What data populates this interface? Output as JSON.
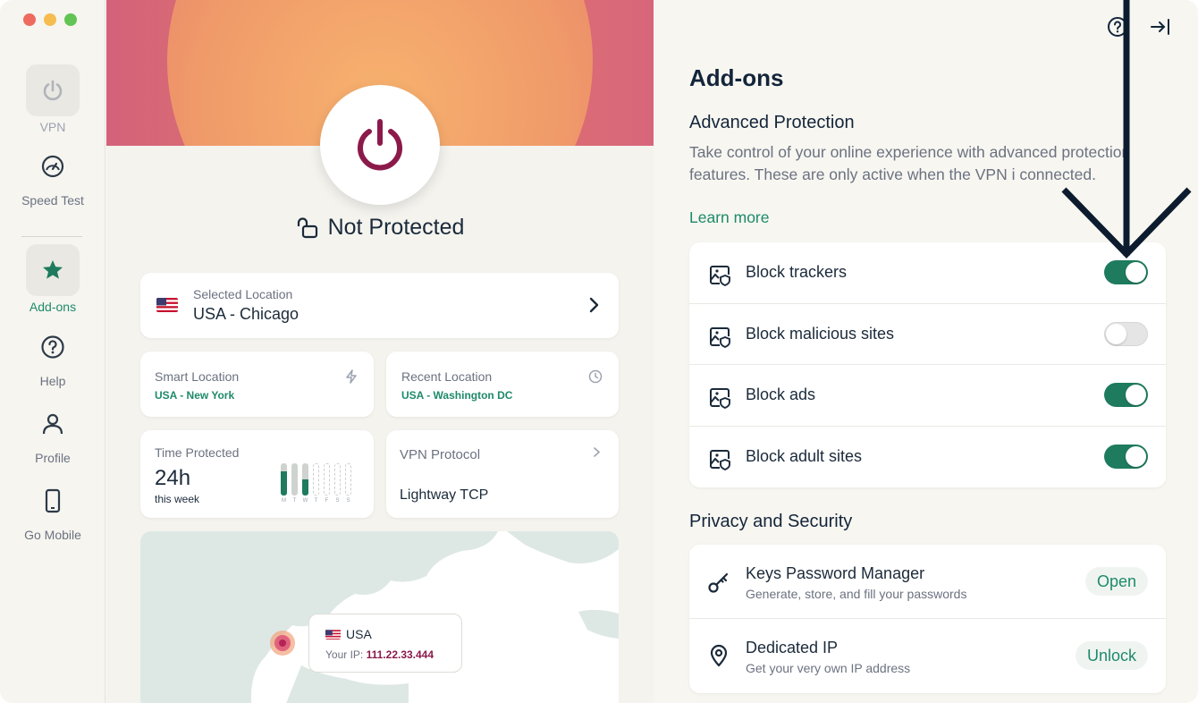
{
  "colors": {
    "accent_green": "#1e7b5e",
    "link_green": "#1e8a6a",
    "brand_magenta": "#8b1a4a",
    "traffic_red": "#ee6a5f",
    "traffic_yellow": "#f5bd4f",
    "traffic_green": "#61c454"
  },
  "sidebar": {
    "items": [
      {
        "label": "VPN",
        "icon": "power-icon"
      },
      {
        "label": "Speed Test",
        "icon": "speedometer-icon"
      },
      {
        "label": "Add-ons",
        "icon": "star-icon",
        "active": true
      },
      {
        "label": "Help",
        "icon": "question-icon"
      },
      {
        "label": "Profile",
        "icon": "person-icon"
      },
      {
        "label": "Go Mobile",
        "icon": "phone-icon"
      }
    ]
  },
  "center": {
    "status_text": "Not Protected",
    "selected_location": {
      "label": "Selected Location",
      "value": "USA - Chicago"
    },
    "smart_location": {
      "label": "Smart Location",
      "value": "USA - New York"
    },
    "recent_location": {
      "label": "Recent Location",
      "value": "USA - Washington DC"
    },
    "time_protected": {
      "label": "Time Protected",
      "value": "24h",
      "sub": "this week",
      "days": [
        "M",
        "T",
        "W",
        "T",
        "F",
        "S",
        "S"
      ],
      "day_fill": [
        0.75,
        0.0,
        0.5,
        0,
        0,
        0,
        0
      ]
    },
    "vpn_protocol": {
      "label": "VPN Protocol",
      "value": "Lightway TCP"
    },
    "map_tooltip": {
      "country": "USA",
      "ip_label": "Your IP:",
      "ip_value": "111.22.33.444"
    }
  },
  "right": {
    "title": "Add-ons",
    "advanced": {
      "heading": "Advanced Protection",
      "description": "Take control of your online experience with advanced protection features.  These are only active when the VPN i connected.",
      "learn_more": "Learn more",
      "toggles": [
        {
          "label": "Block trackers",
          "on": true
        },
        {
          "label": "Block malicious sites",
          "on": false
        },
        {
          "label": "Block ads",
          "on": true
        },
        {
          "label": "Block adult sites",
          "on": true
        }
      ]
    },
    "privacy": {
      "heading": "Privacy and Security",
      "items": [
        {
          "title": "Keys Password Manager",
          "sub": "Generate, store, and fill your passwords",
          "action": "Open",
          "icon": "key-icon"
        },
        {
          "title": "Dedicated IP",
          "sub": "Get your very own IP address",
          "action": "Unlock",
          "icon": "location-pin-icon"
        }
      ]
    }
  }
}
